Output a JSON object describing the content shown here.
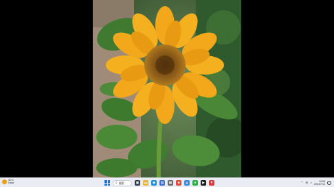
{
  "taskbar": {
    "weather": {
      "temp": "31°C",
      "condition": "Haze"
    },
    "search_label": "搜索",
    "apps": [
      {
        "icon": "task-view-icon",
        "color": "#2f3a4a",
        "glyph": "▣"
      },
      {
        "icon": "file-explorer-icon",
        "color": "#e9b53b",
        "glyph": "▬"
      },
      {
        "icon": "edge-browser-icon",
        "color": "#1c8fd6",
        "glyph": "◉"
      },
      {
        "icon": "store-icon",
        "color": "#3b6fd6",
        "glyph": "▤"
      },
      {
        "icon": "xbox-icon",
        "color": "#6a6a6a",
        "glyph": "▦"
      },
      {
        "icon": "red-app-icon",
        "color": "#e04a3a",
        "glyph": "■"
      },
      {
        "icon": "photos-icon",
        "color": "#3f8ae0",
        "glyph": "▲"
      },
      {
        "icon": "wechat-icon",
        "color": "#2bb04a",
        "glyph": "●"
      },
      {
        "icon": "media-player-icon",
        "color": "#1d1d1d",
        "glyph": "▶"
      },
      {
        "icon": "vpn-app-icon",
        "color": "#d93a3a",
        "glyph": "▼"
      }
    ],
    "tray": {
      "time": "19:53",
      "date": "2024/7/14"
    }
  }
}
